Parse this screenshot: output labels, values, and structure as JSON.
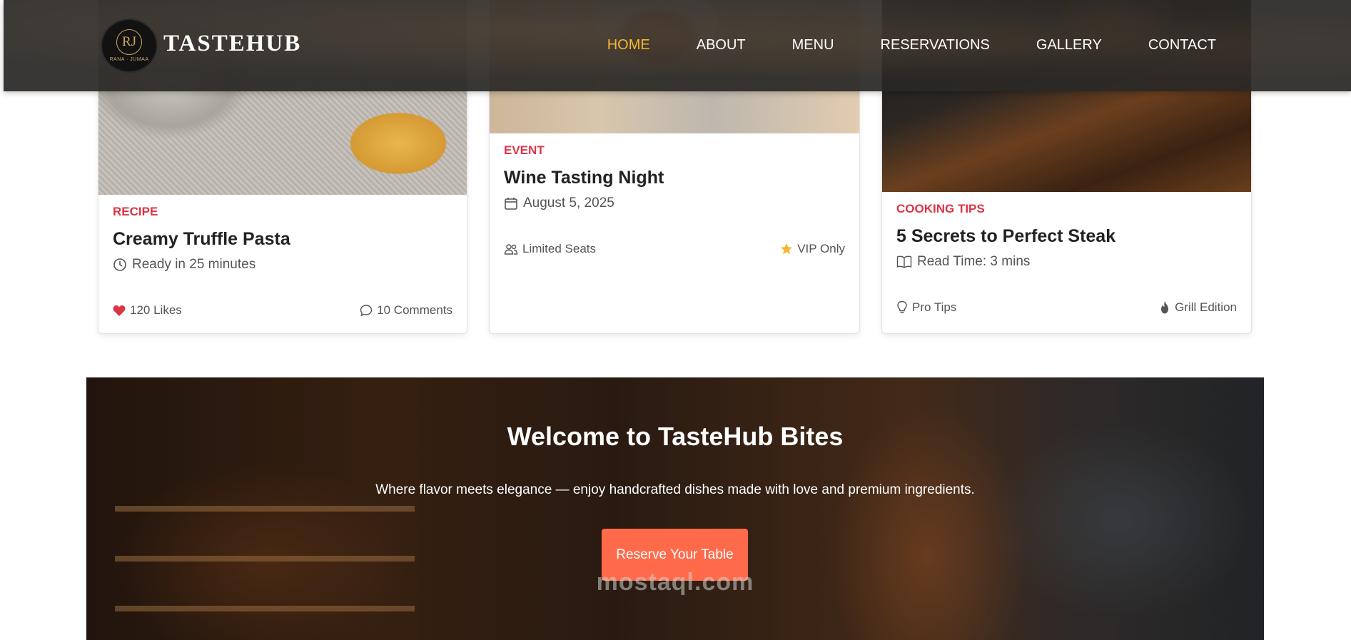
{
  "brand": {
    "name": "TASTEHUB",
    "logo_monogram": "RJ",
    "logo_subtext": "RANA · JUMAA"
  },
  "nav": {
    "items": [
      "HOME",
      "ABOUT",
      "MENU",
      "RESERVATIONS",
      "GALLERY",
      "CONTACT"
    ],
    "active": "HOME"
  },
  "cards": [
    {
      "category": "RECIPE",
      "title": "Creamy Truffle Pasta",
      "meta": "Ready in 25 minutes",
      "meta_icon": "clock-icon",
      "foot_left": "120 Likes",
      "foot_left_icon": "heart-icon",
      "foot_right": "10 Comments",
      "foot_right_icon": "comment-icon"
    },
    {
      "category": "EVENT",
      "title": "Wine Tasting Night",
      "meta": "August 5, 2025",
      "meta_icon": "calendar-icon",
      "foot_left": "Limited Seats",
      "foot_left_icon": "people-icon",
      "foot_right": "VIP Only",
      "foot_right_icon": "star-icon"
    },
    {
      "category": "COOKING TIPS",
      "title": "5 Secrets to Perfect Steak",
      "meta": "Read Time: 3 mins",
      "meta_icon": "book-icon",
      "foot_left": "Pro Tips",
      "foot_left_icon": "lightbulb-icon",
      "foot_right": "Grill Edition",
      "foot_right_icon": "fire-icon"
    }
  ],
  "hero": {
    "title": "Welcome to TasteHub Bites",
    "subtitle": "Where flavor meets elegance — enjoy handcrafted dishes made with love and premium ingredients.",
    "button": "Reserve Your Table",
    "watermark": "mostaql.com"
  },
  "colors": {
    "accent_nav": "#f5b82e",
    "category": "#dc3545",
    "button": "#ff6b4a",
    "heart": "#dc3545",
    "star": "#f5b82e"
  }
}
